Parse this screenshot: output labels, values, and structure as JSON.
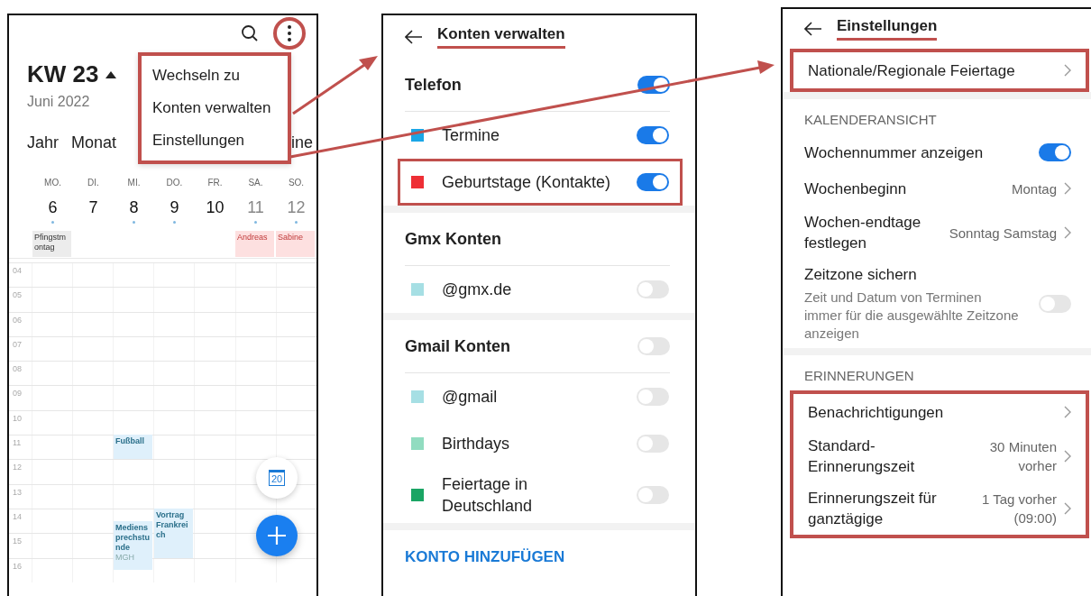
{
  "calendar": {
    "more_circled": true,
    "week_label": "KW 23",
    "month": "Juni 2022",
    "view_tabs": [
      "Jahr",
      "Monat",
      "ine"
    ],
    "menu": {
      "highlighted": true,
      "items": [
        "Wechseln zu",
        "Konten verwalten",
        "Einstellungen"
      ]
    },
    "days": [
      {
        "weekday": "MO.",
        "date": "6",
        "weekend": false,
        "has_events": true,
        "all_day": {
          "title": "Pfingstmontag",
          "kind": "holiday"
        }
      },
      {
        "weekday": "DI.",
        "date": "7",
        "weekend": false,
        "has_events": false
      },
      {
        "weekday": "MI.",
        "date": "8",
        "weekend": false,
        "has_events": true,
        "events": [
          {
            "title": "Fußball"
          },
          {
            "title": "Mediensprechstunde",
            "location": "MGH"
          }
        ]
      },
      {
        "weekday": "DO.",
        "date": "9",
        "weekend": false,
        "has_events": true,
        "events": [
          {
            "title": "Vortrag Frankreich"
          }
        ]
      },
      {
        "weekday": "FR.",
        "date": "10",
        "weekend": false,
        "has_events": false
      },
      {
        "weekday": "SA.",
        "date": "11",
        "weekend": true,
        "has_events": true,
        "all_day": {
          "title": "Andreas",
          "kind": "birthday"
        }
      },
      {
        "weekday": "SO.",
        "date": "12",
        "weekend": true,
        "has_events": true,
        "all_day": {
          "title": "Sabine",
          "kind": "birthday"
        }
      }
    ],
    "hours": [
      "04",
      "05",
      "06",
      "07",
      "08",
      "09",
      "10",
      "11",
      "12",
      "13",
      "14",
      "15",
      "16"
    ],
    "today_button": "20"
  },
  "accounts": {
    "title": "Konten verwalten",
    "title_underlined": true,
    "groups": [
      {
        "name": "Telefon",
        "on": true,
        "items": [
          {
            "label": "Termine",
            "color": "#1ba6e6",
            "on": true,
            "highlighted": false
          },
          {
            "label": "Geburtstage (Kontakte)",
            "color": "#ee2f35",
            "on": true,
            "highlighted": true
          }
        ]
      },
      {
        "name": "Gmx Konten",
        "items": [
          {
            "label": "@gmx.de",
            "color": "#a6dfe4",
            "on": false,
            "highlighted": false
          }
        ]
      },
      {
        "name": "Gmail Konten",
        "on": false,
        "items": [
          {
            "label": "@gmail",
            "color": "#a6dfe4",
            "on": false,
            "highlighted": false
          },
          {
            "label": "Birthdays",
            "color": "#91dcc0",
            "on": false,
            "highlighted": false
          },
          {
            "label": "Feiertage in Deutschland",
            "color": "#1aa564",
            "on": false,
            "highlighted": false
          }
        ]
      }
    ],
    "add_account": "KONTO HINZUFÜGEN"
  },
  "settings": {
    "title": "Einstellungen",
    "title_underlined": true,
    "sections": [
      {
        "highlighted": true,
        "items": [
          {
            "kind": "link",
            "label": "Nationale/Regionale Feiertage"
          }
        ]
      },
      {
        "heading": "KALENDERANSICHT",
        "items": [
          {
            "kind": "toggle",
            "label": "Wochennummer anzeigen",
            "on": true
          },
          {
            "kind": "link",
            "label": "Wochenbeginn",
            "value": "Montag"
          },
          {
            "kind": "link",
            "label": "Wochen-endtage festlegen",
            "value": "Sonntag Samstag"
          },
          {
            "kind": "toggle",
            "label": "Zeitzone sichern",
            "description": "Zeit und Datum von Terminen immer für die ausgewählte Zeitzone anzeigen",
            "on": false
          }
        ]
      },
      {
        "heading": "ERINNERUNGEN",
        "highlighted": true,
        "items": [
          {
            "kind": "link",
            "label": "Benachrichtigungen"
          },
          {
            "kind": "link",
            "label": "Standard-Erinnerungszeit",
            "value": "30 Minuten vorher"
          },
          {
            "kind": "link",
            "label": "Erinnerungszeit für ganztägige",
            "value": "1 Tag vorher (09:00)"
          }
        ]
      }
    ]
  }
}
